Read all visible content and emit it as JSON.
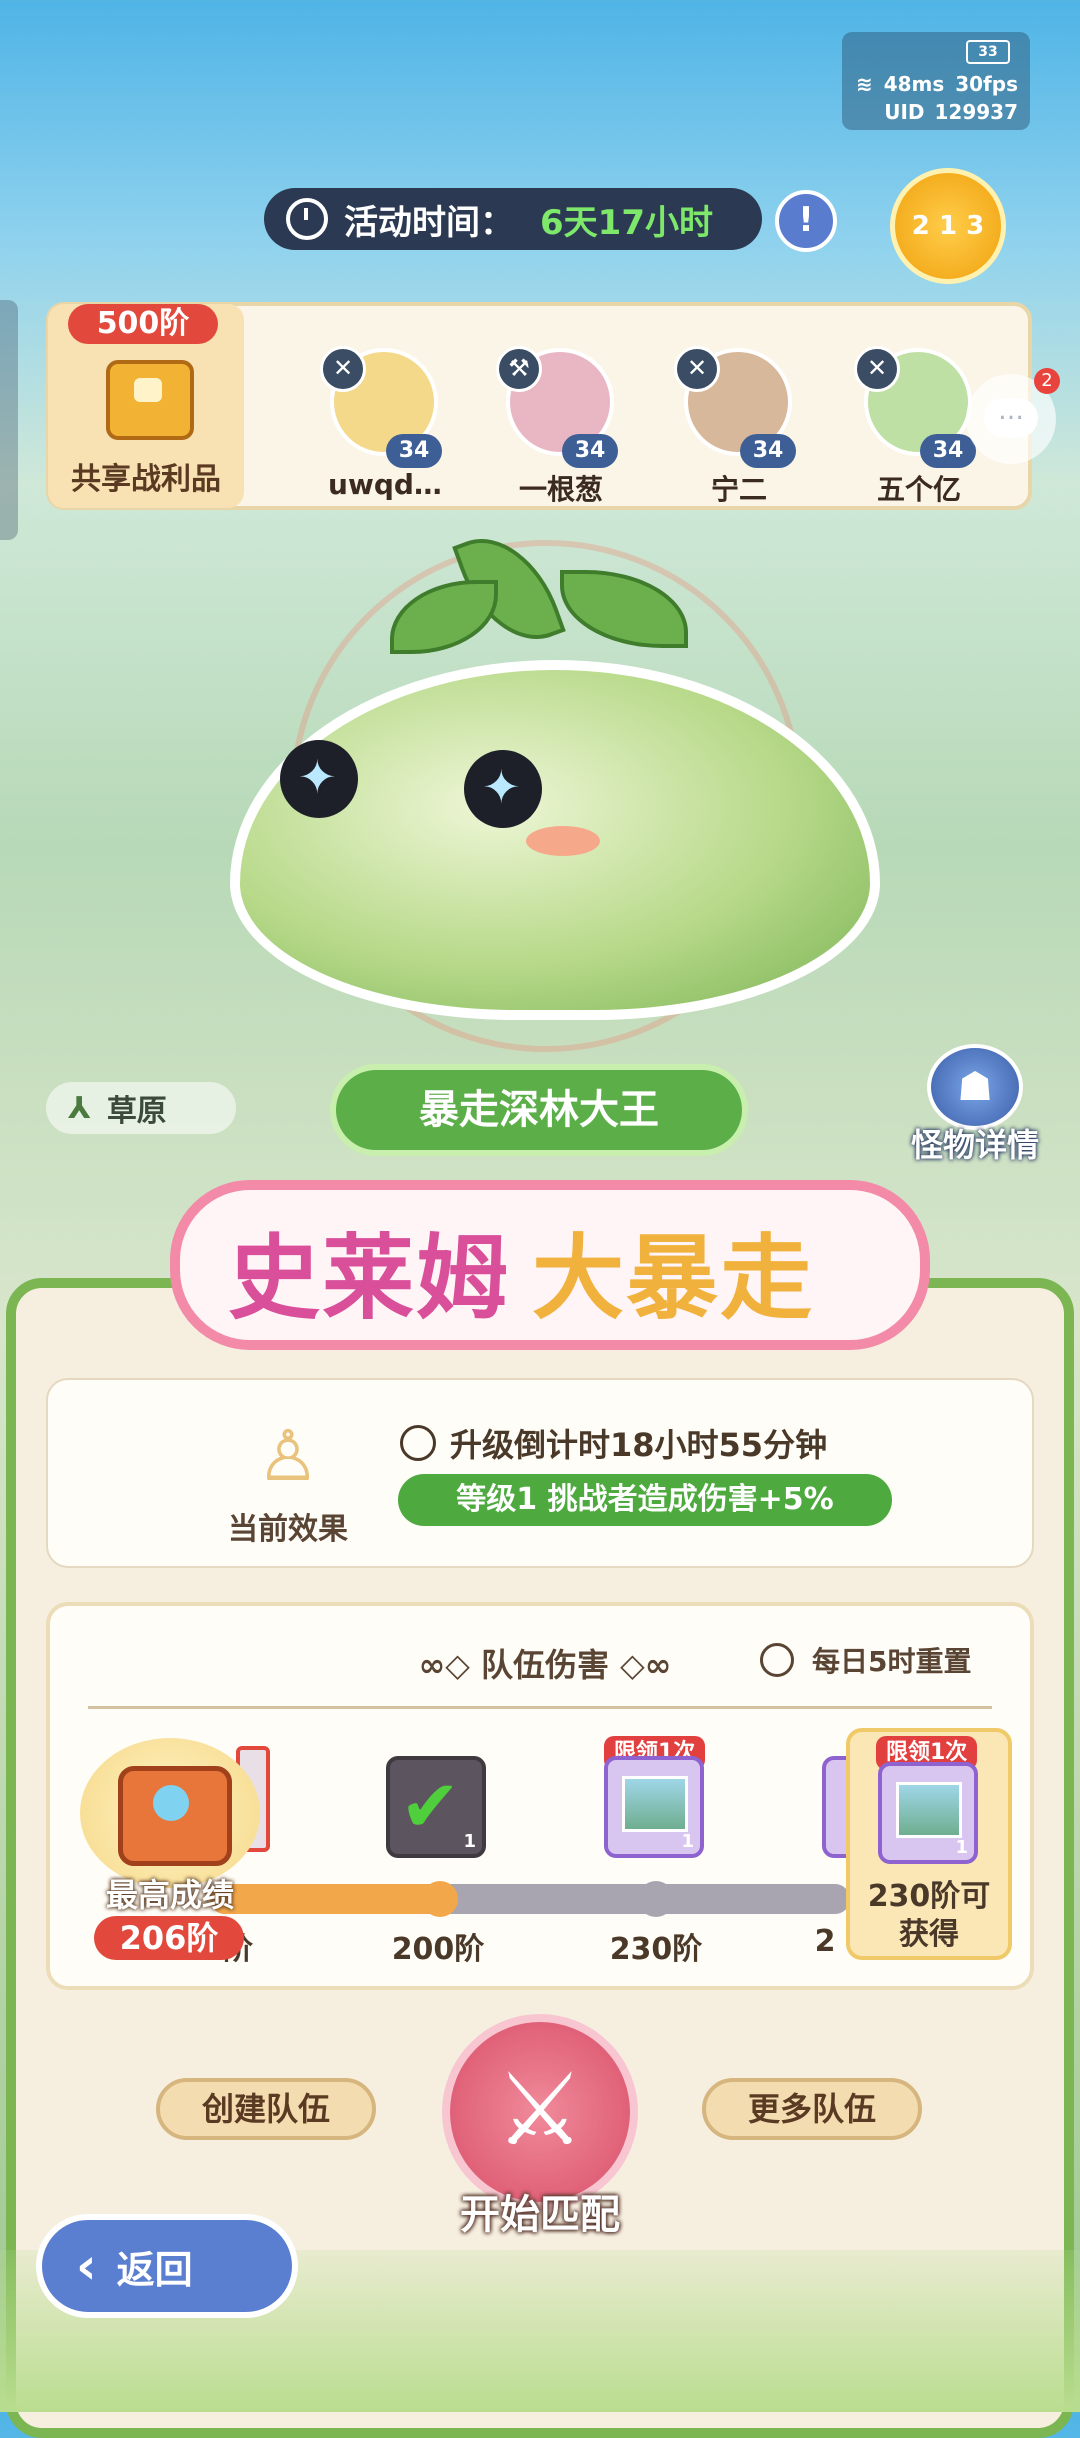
{
  "hud": {
    "battery": "33",
    "ping": "48ms",
    "fps": "30fps",
    "uid_label": "UID",
    "uid": "129937"
  },
  "event": {
    "label": "活动时间：",
    "remaining": "6天17小时"
  },
  "ranking": {
    "digits": "2 1 3"
  },
  "team": {
    "shared_loot_badge": "500阶",
    "shared_loot_label": "共享战利品",
    "members": [
      {
        "name": "uwqd…",
        "level": "34",
        "role_icon": "sword-cross-icon",
        "color": "#f5d98a"
      },
      {
        "name": "一根葱",
        "level": "34",
        "role_icon": "wrench-icon",
        "color": "#e9b6c4"
      },
      {
        "name": "宁二",
        "level": "34",
        "role_icon": "sword-cross-icon",
        "color": "#d8b89a"
      },
      {
        "name": "五个亿",
        "level": "34",
        "role_icon": "sword-cross-icon",
        "color": "#bfe0a4"
      }
    ]
  },
  "chat": {
    "unread": "2"
  },
  "boss": {
    "terrain": "草原",
    "name": "暴走深林大王",
    "detail_label": "怪物详情"
  },
  "banner": {
    "part1": "史莱姆",
    "part2": "大暴走"
  },
  "effect": {
    "label": "当前效果",
    "countdown": "升级倒计时18小时55分钟",
    "buff": "等级1 挑战者造成伤害+5%"
  },
  "damage": {
    "title": "队伍伤害",
    "reset": "每日5时重置",
    "best_label": "最高成绩",
    "best_value": "206阶",
    "partial_tier": "阶",
    "progress_ratio": 0.36,
    "rewards": [
      {
        "tier": "200阶",
        "type": "claimed",
        "count": "1",
        "limit": ""
      },
      {
        "tier": "230阶",
        "type": "picture",
        "count": "1",
        "limit": "限领1次"
      },
      {
        "tier": "2",
        "type": "picture",
        "count": "",
        "limit": ""
      }
    ],
    "next": {
      "limit": "限领1次",
      "count": "1",
      "text_line1": "230阶可",
      "text_line2": "获得"
    }
  },
  "buttons": {
    "create": "创建队伍",
    "more": "更多队伍",
    "match": "开始匹配",
    "back": "返回"
  }
}
